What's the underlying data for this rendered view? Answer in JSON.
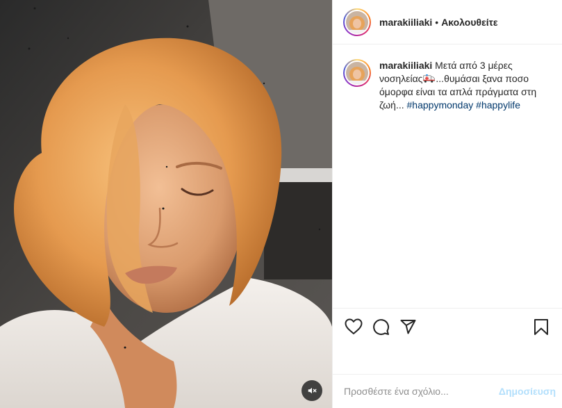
{
  "post": {
    "author": {
      "username": "marakiiliaki",
      "avatar_icon": "profile-photo"
    },
    "header": {
      "separator": "•",
      "follow_status": "Ακολουθείτε"
    },
    "caption": {
      "username": "marakiiliaki",
      "text_part1": "Μετά από 3 μέρες νοσηλείας",
      "emoji_icon": "ambulance-emoji",
      "text_part2": "...θυμάσαι ξανα ποσο όμορφα είναι τα απλά πράγματα στη ζωή...",
      "hashtags": [
        "#happymonday",
        "#happylife"
      ]
    },
    "media": {
      "type": "video",
      "mute_icon": "speaker-muted-icon"
    },
    "actions": {
      "like_icon": "heart-icon",
      "comment_icon": "comment-bubble-icon",
      "share_icon": "paper-plane-icon",
      "save_icon": "bookmark-icon"
    },
    "comment_box": {
      "placeholder": "Προσθέστε ένα σχόλιο...",
      "submit_label": "Δημοσίευση"
    }
  },
  "colors": {
    "text": "#262626",
    "hashtag": "#00376b",
    "submit_disabled": "#b2dffc",
    "placeholder": "#8e8e8e",
    "divider": "#efefef"
  }
}
